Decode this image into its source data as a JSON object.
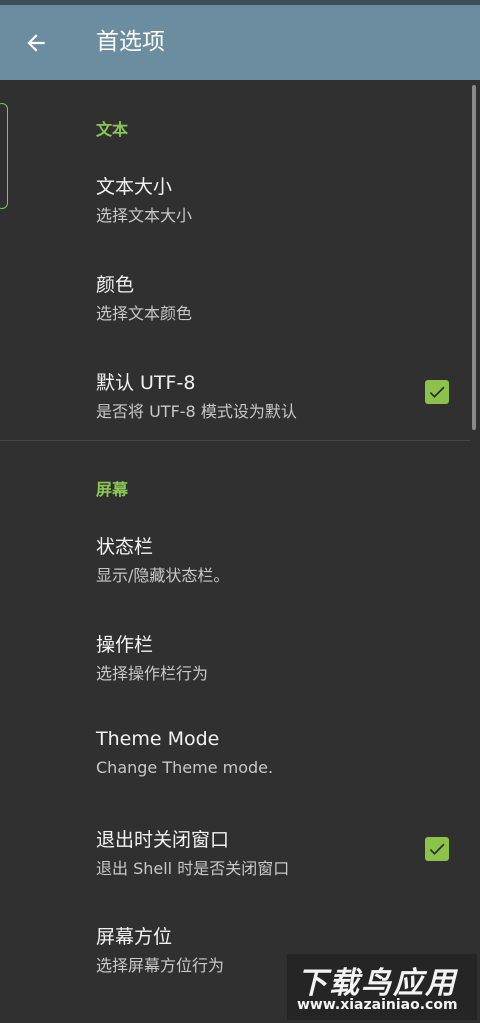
{
  "appbar": {
    "title": "首选项",
    "back_icon": "arrow-left-icon",
    "color": "#6b8d9f"
  },
  "accent_color": "#8ac755",
  "sections": [
    {
      "header": "文本",
      "items": [
        {
          "title": "文本大小",
          "summary": "选择文本大小"
        },
        {
          "title": "颜色",
          "summary": "选择文本颜色"
        },
        {
          "title": "默认 UTF-8",
          "summary": "是否将 UTF-8 模式设为默认",
          "checked": true
        }
      ]
    },
    {
      "header": "屏幕",
      "items": [
        {
          "title": "状态栏",
          "summary": "显示/隐藏状态栏。"
        },
        {
          "title": "操作栏",
          "summary": "选择操作栏行为"
        },
        {
          "title": "Theme Mode",
          "summary": "Change Theme mode."
        },
        {
          "title": "退出时关闭窗口",
          "summary": "退出 Shell 时是否关闭窗口",
          "checked": true
        },
        {
          "title": "屏幕方位",
          "summary": "选择屏幕方位行为"
        }
      ]
    }
  ],
  "watermark": {
    "logo": "下载鸟应用",
    "url": "www.xiazainiao.com"
  }
}
